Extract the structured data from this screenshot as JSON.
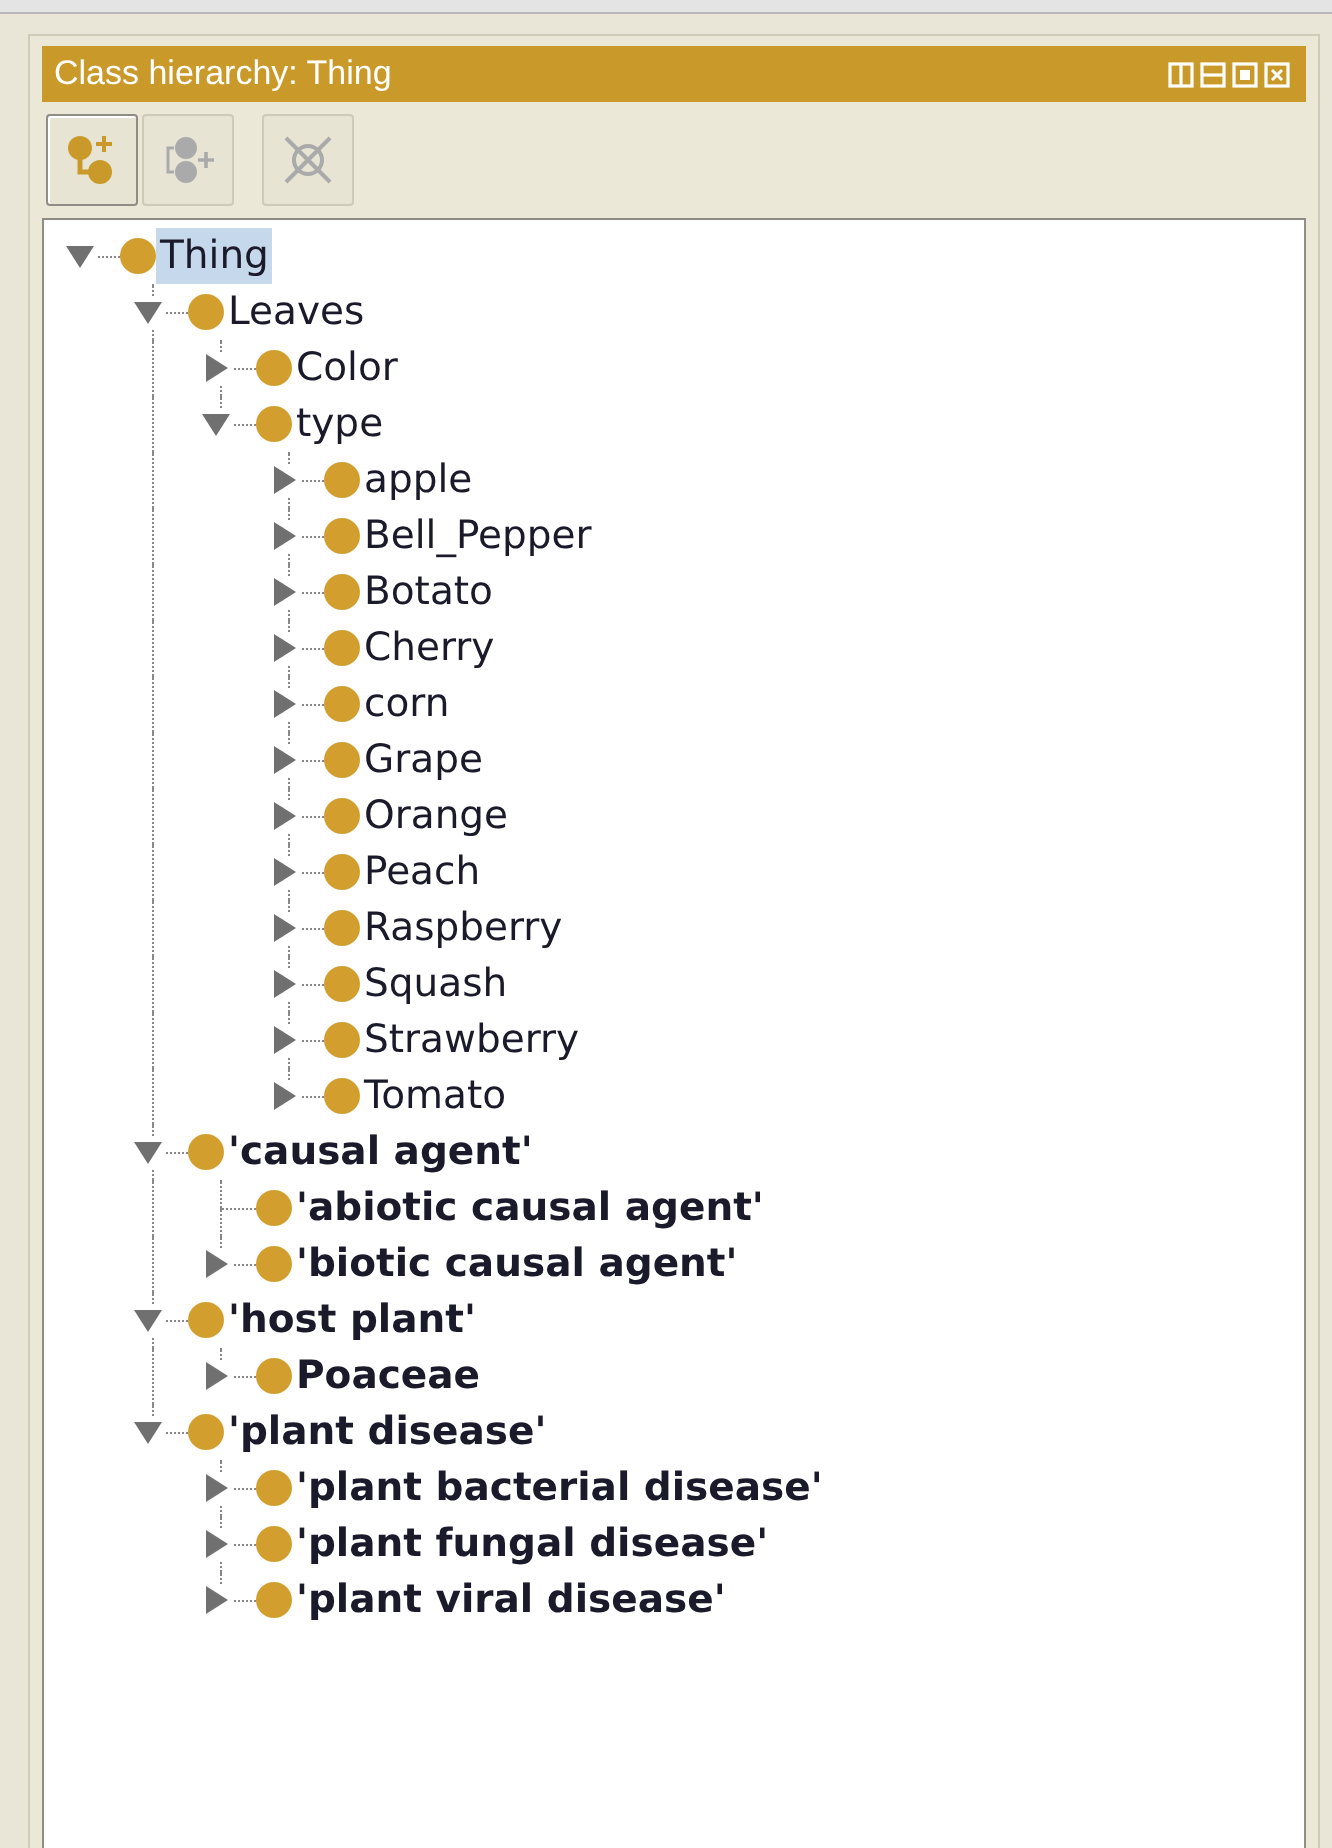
{
  "panel": {
    "title": "Class hierarchy: Thing"
  },
  "toolbar": [
    {
      "kind": "add-subclass",
      "disabled": false
    },
    {
      "kind": "add-sibling",
      "disabled": true
    },
    {
      "kind": "delete",
      "disabled": true
    }
  ],
  "tree": [
    {
      "label": "Thing",
      "bold": false,
      "kind": "branch",
      "expanded": true,
      "selected": true,
      "children": [
        {
          "label": "Leaves",
          "bold": false,
          "kind": "branch",
          "expanded": true,
          "selected": false,
          "children": [
            {
              "label": "Color",
              "bold": false,
              "kind": "branch",
              "expanded": false,
              "selected": false
            },
            {
              "label": "type",
              "bold": false,
              "kind": "branch",
              "expanded": true,
              "selected": false,
              "children": [
                {
                  "label": "apple",
                  "bold": false,
                  "kind": "branch",
                  "expanded": false,
                  "selected": false
                },
                {
                  "label": "Bell_Pepper",
                  "bold": false,
                  "kind": "branch",
                  "expanded": false,
                  "selected": false
                },
                {
                  "label": "Botato",
                  "bold": false,
                  "kind": "branch",
                  "expanded": false,
                  "selected": false
                },
                {
                  "label": "Cherry",
                  "bold": false,
                  "kind": "branch",
                  "expanded": false,
                  "selected": false
                },
                {
                  "label": "corn",
                  "bold": false,
                  "kind": "branch",
                  "expanded": false,
                  "selected": false
                },
                {
                  "label": "Grape",
                  "bold": false,
                  "kind": "branch",
                  "expanded": false,
                  "selected": false
                },
                {
                  "label": "Orange",
                  "bold": false,
                  "kind": "branch",
                  "expanded": false,
                  "selected": false
                },
                {
                  "label": "Peach",
                  "bold": false,
                  "kind": "branch",
                  "expanded": false,
                  "selected": false
                },
                {
                  "label": "Raspberry",
                  "bold": false,
                  "kind": "branch",
                  "expanded": false,
                  "selected": false
                },
                {
                  "label": "Squash",
                  "bold": false,
                  "kind": "branch",
                  "expanded": false,
                  "selected": false
                },
                {
                  "label": "Strawberry",
                  "bold": false,
                  "kind": "branch",
                  "expanded": false,
                  "selected": false
                },
                {
                  "label": "Tomato",
                  "bold": false,
                  "kind": "branch",
                  "expanded": false,
                  "selected": false
                }
              ]
            }
          ]
        },
        {
          "label": "'causal agent'",
          "bold": true,
          "kind": "branch",
          "expanded": true,
          "selected": false,
          "children": [
            {
              "label": "'abiotic causal agent'",
              "bold": true,
              "kind": "leaf",
              "selected": false
            },
            {
              "label": "'biotic causal agent'",
              "bold": true,
              "kind": "branch",
              "expanded": false,
              "selected": false
            }
          ]
        },
        {
          "label": "'host plant'",
          "bold": true,
          "kind": "branch",
          "expanded": true,
          "selected": false,
          "children": [
            {
              "label": "Poaceae",
              "bold": true,
              "kind": "branch",
              "expanded": false,
              "selected": false
            }
          ]
        },
        {
          "label": "'plant disease'",
          "bold": true,
          "kind": "branch",
          "expanded": true,
          "selected": false,
          "children": [
            {
              "label": "'plant bacterial disease'",
              "bold": true,
              "kind": "branch",
              "expanded": false,
              "selected": false
            },
            {
              "label": "'plant fungal disease'",
              "bold": true,
              "kind": "branch",
              "expanded": false,
              "selected": false
            },
            {
              "label": "'plant viral disease'",
              "bold": true,
              "kind": "branch",
              "expanded": false,
              "selected": false
            }
          ]
        }
      ]
    }
  ]
}
